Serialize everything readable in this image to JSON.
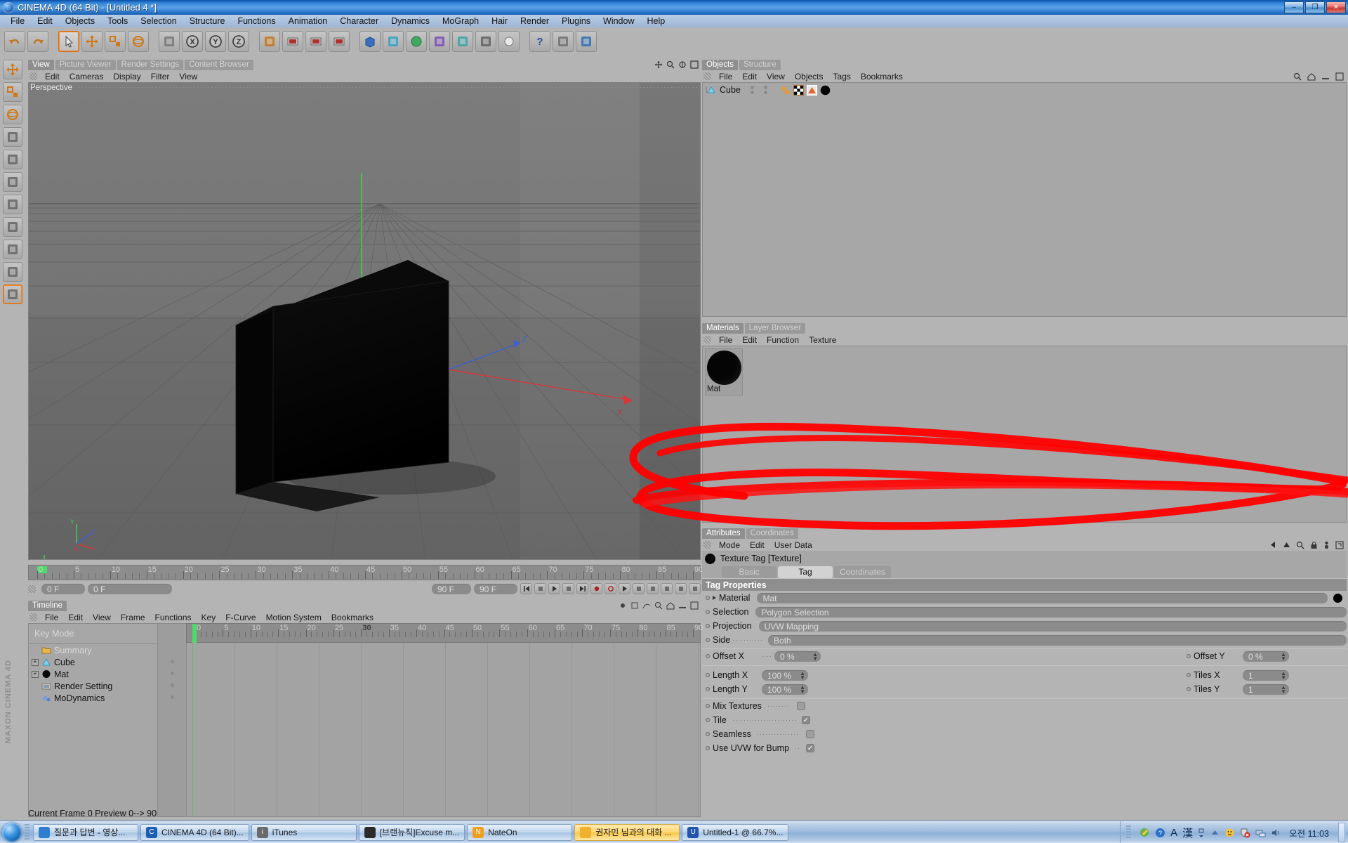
{
  "window": {
    "title": "CINEMA 4D (64 Bit) - [Untitled 4 *]",
    "minimize": "–",
    "maximize": "❐",
    "close": "✕",
    "app_icon": "cinema4d-logo-icon"
  },
  "menubar": {
    "items": [
      "File",
      "Edit",
      "Objects",
      "Tools",
      "Selection",
      "Structure",
      "Functions",
      "Animation",
      "Character",
      "Dynamics",
      "MoGraph",
      "Hair",
      "Render",
      "Plugins",
      "Window",
      "Help"
    ]
  },
  "viewport_panel": {
    "tabs": [
      {
        "label": "View",
        "active": true
      },
      {
        "label": "Picture Viewer",
        "active": false
      },
      {
        "label": "Render Settings",
        "active": false
      },
      {
        "label": "Content Browser",
        "active": false
      }
    ],
    "menu": [
      "Edit",
      "Cameras",
      "Display",
      "Filter",
      "View"
    ],
    "view_label": "Perspective",
    "axis_labels": {
      "x": "X",
      "y": "Y",
      "z": "Z"
    }
  },
  "objects_panel": {
    "tabs": [
      {
        "label": "Objects",
        "active": true
      },
      {
        "label": "Structure",
        "active": false
      }
    ],
    "menu": [
      "File",
      "Edit",
      "View",
      "Objects",
      "Tags",
      "Bookmarks"
    ],
    "rows": [
      {
        "name": "Cube",
        "icon": "cube-object-icon",
        "tags": [
          "mograph-tag-icon",
          "texture-tag-icon",
          "polygon-selection-tag-icon",
          "material-tag-icon"
        ]
      }
    ],
    "header_icons": [
      "search-icon",
      "home-icon",
      "minimize-panel-icon",
      "maximize-panel-icon"
    ]
  },
  "materials_panel": {
    "tabs": [
      {
        "label": "Materials",
        "active": true
      },
      {
        "label": "Layer Browser",
        "active": false
      }
    ],
    "menu": [
      "File",
      "Edit",
      "Function",
      "Texture"
    ],
    "materials": [
      {
        "name": "Mat",
        "color": "#050505"
      }
    ]
  },
  "attributes_panel": {
    "tabs": [
      {
        "label": "Attributes",
        "active": true
      },
      {
        "label": "Coordinates",
        "active": false
      }
    ],
    "menu": [
      "Mode",
      "Edit",
      "User Data"
    ],
    "header_icons": [
      "back-arrow-icon",
      "up-arrow-icon",
      "search-icon",
      "lock-icon",
      "pin-icon",
      "expand-icon"
    ],
    "object_title": "Texture Tag [Texture]",
    "subtabs": [
      {
        "label": "Basic",
        "active": false
      },
      {
        "label": "Tag",
        "active": true
      },
      {
        "label": "Coordinates",
        "active": false
      }
    ],
    "section_title": "Tag Properties",
    "properties": [
      {
        "label": "Material",
        "value": "Mat",
        "type": "field",
        "expandable": true,
        "has_swatch": true
      },
      {
        "label": "Selection",
        "value": "Polygon Selection",
        "type": "field"
      },
      {
        "label": "Projection",
        "value": "UVW Mapping",
        "type": "field"
      },
      {
        "label": "Side",
        "value": "Both",
        "type": "field",
        "dotted": true
      }
    ],
    "numeric_left": [
      {
        "label": "Offset X",
        "value": "0 %"
      },
      {
        "label": "Length X",
        "value": "100 %"
      },
      {
        "label": "Length Y",
        "value": "100 %"
      }
    ],
    "numeric_right": [
      {
        "label": "Offset Y",
        "value": "0 %"
      },
      {
        "label": "Tiles X",
        "value": "1"
      },
      {
        "label": "Tiles Y",
        "value": "1"
      }
    ],
    "checkboxes": [
      {
        "label": "Mix Textures",
        "checked": false
      },
      {
        "label": "Tile",
        "checked": true
      },
      {
        "label": "Seamless",
        "checked": false
      },
      {
        "label": "Use UVW for Bump",
        "checked": true
      }
    ]
  },
  "anim_bar": {
    "current_frame_field": "0 F",
    "current_frame_field2": "0 F",
    "end_marker": "90 F",
    "end_field": "90 F",
    "preview_end": "90 F",
    "viewport_frame_field": "0 F",
    "ruler_max": 90,
    "ruler_labels": [
      0,
      5,
      10,
      15,
      20,
      25,
      30,
      35,
      40,
      45,
      50,
      55,
      60,
      65,
      70,
      75,
      80,
      85,
      90
    ]
  },
  "timeline_panel": {
    "tabs": [
      {
        "label": "Timeline",
        "active": true
      }
    ],
    "menu": [
      "File",
      "Edit",
      "View",
      "Frame",
      "Functions",
      "Key",
      "F-Curve",
      "Motion System",
      "Bookmarks"
    ],
    "key_mode": "Key Mode",
    "ruler_labels": [
      0,
      5,
      10,
      15,
      20,
      25,
      30,
      35,
      40,
      45,
      50,
      55,
      60,
      65,
      70,
      75,
      80,
      85,
      90
    ],
    "rows": [
      {
        "name": "Summary",
        "icon": "folder-icon",
        "expandable": false
      },
      {
        "name": "Cube",
        "icon": "cube-object-icon",
        "expandable": true
      },
      {
        "name": "Mat",
        "icon": "material-sphere-icon",
        "expandable": true
      },
      {
        "name": "Render Setting",
        "icon": "render-settings-icon",
        "expandable": false
      },
      {
        "name": "MoDynamics",
        "icon": "modynamics-icon",
        "expandable": false
      }
    ]
  },
  "status_bar": {
    "text": "Current Frame  0  Preview  0--> 90"
  },
  "left_toolbar": {
    "tools": [
      "move-tool-icon",
      "scale-tool-icon",
      "rotate-tool-icon",
      "point-mode-icon",
      "edge-mode-icon",
      "polygon-mode-icon",
      "model-mode-icon",
      "object-axis-icon",
      "texture-mode-icon",
      "texture-axis-icon",
      "animation-mode-icon"
    ],
    "watermark": "MAXON CINEMA 4D"
  },
  "top_toolbar": {
    "tools": [
      "undo-icon",
      "redo-icon",
      "select-tool-icon",
      "move-tool-icon",
      "scale-tool-icon",
      "rotate-tool-icon",
      "world-axis-icon",
      "lock-x-icon",
      "lock-y-icon",
      "lock-z-icon",
      "world-object-icon",
      "render-view-icon",
      "render-region-icon",
      "render-settings-icon",
      "add-cube-icon",
      "add-spline-icon",
      "add-generator-icon",
      "add-deformer-icon",
      "add-environment-icon",
      "add-camera-icon",
      "add-light-icon",
      "help-icon",
      "layout-icon",
      "content-browser-icon"
    ]
  },
  "taskbar": {
    "start": "windows-start-orb-icon",
    "buttons": [
      {
        "label": "질문과 답변 - 영상...",
        "icon": "ie-browser-icon",
        "color": "#2f7fd0",
        "active": false
      },
      {
        "label": "CINEMA 4D (64 Bit)...",
        "icon": "cinema4d-logo-icon",
        "color": "#1d5fae",
        "active": false
      },
      {
        "label": "iTunes",
        "icon": "itunes-icon",
        "color": "#6a6a6a",
        "active": false
      },
      {
        "label": "[브랜뉴직]Excuse m...",
        "icon": "media-player-icon",
        "color": "#2b2b2b",
        "active": false
      },
      {
        "label": "NateOn",
        "icon": "nateon-icon",
        "color": "#f0a020",
        "active": false
      },
      {
        "label": "권자민 님과의 대화 ...",
        "icon": "chat-icon",
        "color": "#f0b030",
        "active": true
      },
      {
        "label": "Untitled-1 @ 66.7%...",
        "icon": "photoshop-icon",
        "color": "#2255aa",
        "active": false
      }
    ],
    "tray": {
      "icons": [
        "paint-tray-icon",
        "help-tray-icon",
        "ime-A-icon",
        "ime-hanja-icon",
        "ime-options-icon",
        "show-hidden-icon",
        "notification-icon",
        "security-alert-icon",
        "network-icon",
        "volume-icon"
      ],
      "ime_a": "A",
      "ime_hanja": "漢",
      "clock": "오전 11:03"
    }
  },
  "annotation": {
    "type": "red-marker-ellipse",
    "color": "#ff0000"
  }
}
